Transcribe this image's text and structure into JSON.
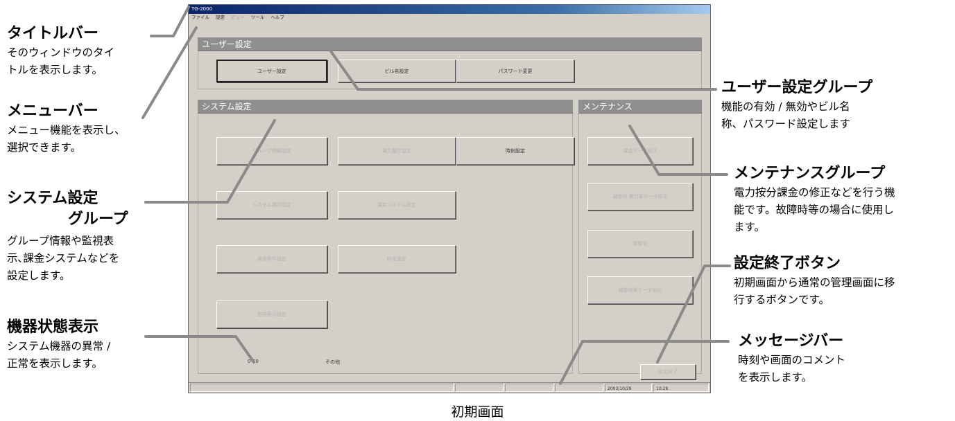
{
  "annotations": {
    "titlebar": {
      "title": "タイトルバー",
      "desc": [
        "そのウィンドウのタイ",
        "トルを表示します。"
      ]
    },
    "menubar": {
      "title": "メニューバー",
      "desc": [
        "メニュー機能を表示し、",
        "選択できます。"
      ]
    },
    "system_group": {
      "title1": "システム設定",
      "title2": "グループ",
      "desc": [
        "グループ情報や監視表",
        "示､課金システムなどを",
        "設定します。"
      ]
    },
    "device_status": {
      "title": "機器状態表示",
      "desc": [
        "システム機器の異常 /",
        "正常を表示します。"
      ]
    },
    "user_group": {
      "title": "ユーザー設定グループ",
      "desc": [
        "機能の有効 / 無効やビル名",
        "称、パスワード設定します"
      ]
    },
    "maint_group": {
      "title": "メンテナンスグループ",
      "desc": [
        "電力按分課金の修正などを行う機",
        "能です。故障時等の場合に使用し",
        "ます。"
      ]
    },
    "finish_button": {
      "title": "設定終了ボタン",
      "desc": [
        "初期画面から通常の管理画面に移",
        "行するボタンです。"
      ]
    },
    "message_bar": {
      "title": "メッセージバー",
      "desc": [
        "時刻や画面のコメント",
        "を表示します。"
      ]
    }
  },
  "caption": "初期画面",
  "window": {
    "title": "TG-2000",
    "menu": [
      "ファイル",
      "設定",
      "ビュー",
      "ツール",
      "ヘルプ"
    ],
    "user_header": "ユーザー設定",
    "user_buttons": [
      "ユーザー設定",
      "ビル名設定",
      "パスワード変更"
    ],
    "system_header": "システム設定",
    "system_buttons": [
      "グループ情報設定",
      "電力量計設定",
      "時刻設定",
      "システム構成設定",
      "課金システム設定",
      "運用条件設定",
      "料金設定",
      "監視表示設定"
    ],
    "maint_header": "メンテナンス",
    "maint_buttons": [
      "課金データ修正",
      "課金用 電力量データ修正",
      "初期化",
      "課金対象データ抽出"
    ],
    "finish_label": "設定終了",
    "status_label": "0-50",
    "status_value": "その他",
    "date": "2003/10/29",
    "time": "10:28"
  }
}
